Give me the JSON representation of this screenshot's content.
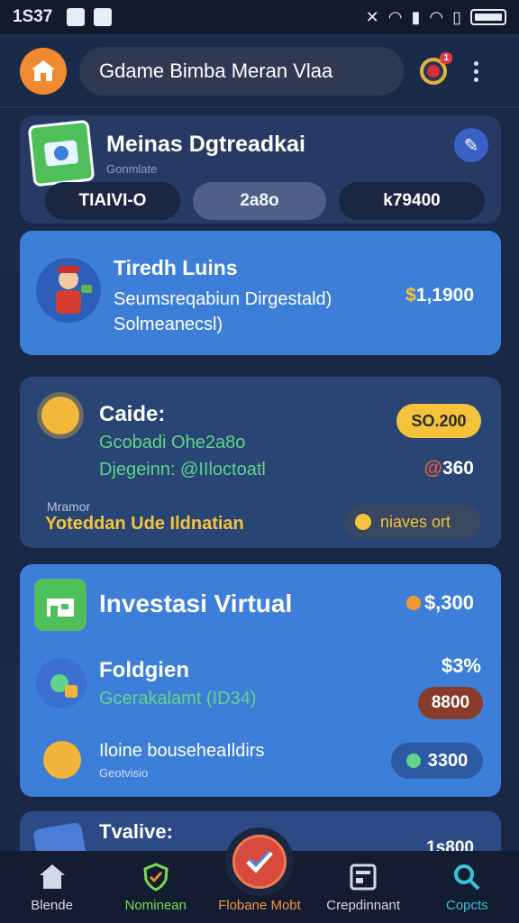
{
  "status": {
    "time": "1S37"
  },
  "header": {
    "search_text": "Gdame Bimba Meran Vlaa",
    "notif_count": "1"
  },
  "summary": {
    "title": "Meinas Dgtreadkai",
    "subtitle": "Gonmlate",
    "pills": [
      "TIAIVI-O",
      "2a8o",
      "k79400"
    ]
  },
  "card1": {
    "name": "Tiredh Luins",
    "desc_line1": "Seumsreqabiun Dirgestald)",
    "desc_line2": "Solmeanecsl)",
    "amount_currency": "$",
    "amount_value": "1,1900"
  },
  "card2": {
    "name": "Caide:",
    "line1": "Gcobadi Ohe2a8o",
    "line2": "Djegeinn: @IIloctoatl",
    "badge": "SO.200",
    "value_mark": "@",
    "value": "360",
    "caption": "Mramor",
    "caption_value": "Yoteddan Ude Ildnatian",
    "chip_label": "niaves ort"
  },
  "card3": {
    "title": "Investasi Virtual",
    "title_amount": "$,300",
    "f_name": "Foldgien",
    "f_sub": "Gcerakalamt (ID34)",
    "f_pct": "$3%",
    "f_pill": "8800",
    "h_name": "Iloine bouseheaIldirs",
    "h_sub": "Geotvisio",
    "h_pill": "3300"
  },
  "card4": {
    "name": "Tvalive:",
    "amount": "1s800"
  },
  "nav": [
    {
      "label": "Blende",
      "color": "#d3d9e6"
    },
    {
      "label": "Nominean",
      "color": "#7bdc54"
    },
    {
      "label": "Flobane Mobt",
      "color": "#f2943a"
    },
    {
      "label": "Crepdinnant",
      "color": "#d3d9e6"
    },
    {
      "label": "Copcts",
      "color": "#38c4d8"
    }
  ],
  "colors": {
    "accent_orange": "#f08a2e",
    "card_blue": "#3d7fd8",
    "yellow": "#f5c33b",
    "green": "#5fd48a"
  }
}
